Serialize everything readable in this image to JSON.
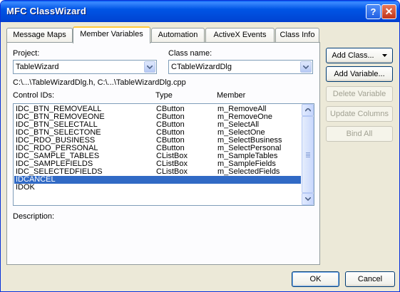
{
  "window": {
    "title": "MFC ClassWizard",
    "help_button": "?",
    "close_button": "✕"
  },
  "tabs": [
    "Message Maps",
    "Member Variables",
    "Automation",
    "ActiveX Events",
    "Class Info"
  ],
  "active_tab": "Member Variables",
  "project": {
    "label": "Project:",
    "value": "TableWizard"
  },
  "class_name": {
    "label": "Class name:",
    "value": "CTableWizardDlg"
  },
  "files_path": "C:\\...\\TableWizardDlg.h, C:\\...\\TableWizardDlg.cpp",
  "list": {
    "headers": {
      "control_ids": "Control IDs:",
      "type": "Type",
      "member": "Member"
    },
    "rows": [
      {
        "id": "IDC_BTN_REMOVEALL",
        "type": "CButton",
        "member": "m_RemoveAll"
      },
      {
        "id": "IDC_BTN_REMOVEONE",
        "type": "CButton",
        "member": "m_RemoveOne"
      },
      {
        "id": "IDC_BTN_SELECTALL",
        "type": "CButton",
        "member": "m_SelectAll"
      },
      {
        "id": "IDC_BTN_SELECTONE",
        "type": "CButton",
        "member": "m_SelectOne"
      },
      {
        "id": "IDC_RDO_BUSINESS",
        "type": "CButton",
        "member": "m_SelectBusiness"
      },
      {
        "id": "IDC_RDO_PERSONAL",
        "type": "CButton",
        "member": "m_SelectPersonal"
      },
      {
        "id": "IDC_SAMPLE_TABLES",
        "type": "CListBox",
        "member": "m_SampleTables"
      },
      {
        "id": "IDC_SAMPLEFIELDS",
        "type": "CListBox",
        "member": "m_SampleFields"
      },
      {
        "id": "IDC_SELECTEDFIELDS",
        "type": "CListBox",
        "member": "m_SelectedFields"
      },
      {
        "id": "IDCANCEL",
        "type": "",
        "member": ""
      },
      {
        "id": "IDOK",
        "type": "",
        "member": ""
      }
    ],
    "selected_row": "IDCANCEL"
  },
  "description_label": "Description:",
  "side_buttons": {
    "add_class": "Add Class...",
    "add_variable": "Add Variable...",
    "delete_variable": "Delete Variable",
    "update_columns": "Update Columns",
    "bind_all": "Bind All"
  },
  "footer": {
    "ok": "OK",
    "cancel": "Cancel"
  },
  "icons": {
    "dropdown": "chevron-down-icon",
    "scroll_up": "arrow-up-icon",
    "scroll_down": "arrow-down-icon"
  },
  "colors": {
    "title_bar": "#0055e5",
    "selection": "#316ac5",
    "dialog_bg": "#ece9d8",
    "active_tab_accent": "#ffc83c"
  }
}
